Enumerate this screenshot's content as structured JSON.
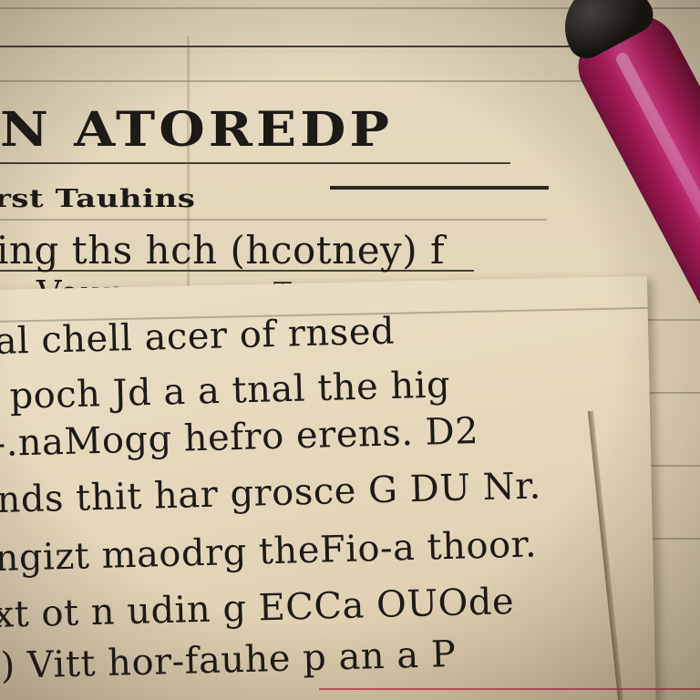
{
  "title": "N ATOREDP",
  "subtitle": "rst Tauhins",
  "lines": [
    "ing ths hch (hcotney) f",
    "Vour",
    "T"
  ],
  "body": [
    "al chell acer of rnsed",
    "poch Jd a a tnal the hig",
    "-.naMogg hefro erens. D2",
    "nds thit har grosce G DU Nr.",
    "ngizt maodrg theFio-a thoor.",
    "xt ot n udin g ECCa  OUOde",
    ") Vitt hor-fauhe p an a P"
  ],
  "colors": {
    "paper": "#e6dac0",
    "ink": "#1d1a18",
    "pen_body": "#c21f6a",
    "pen_cap": "#111111"
  }
}
